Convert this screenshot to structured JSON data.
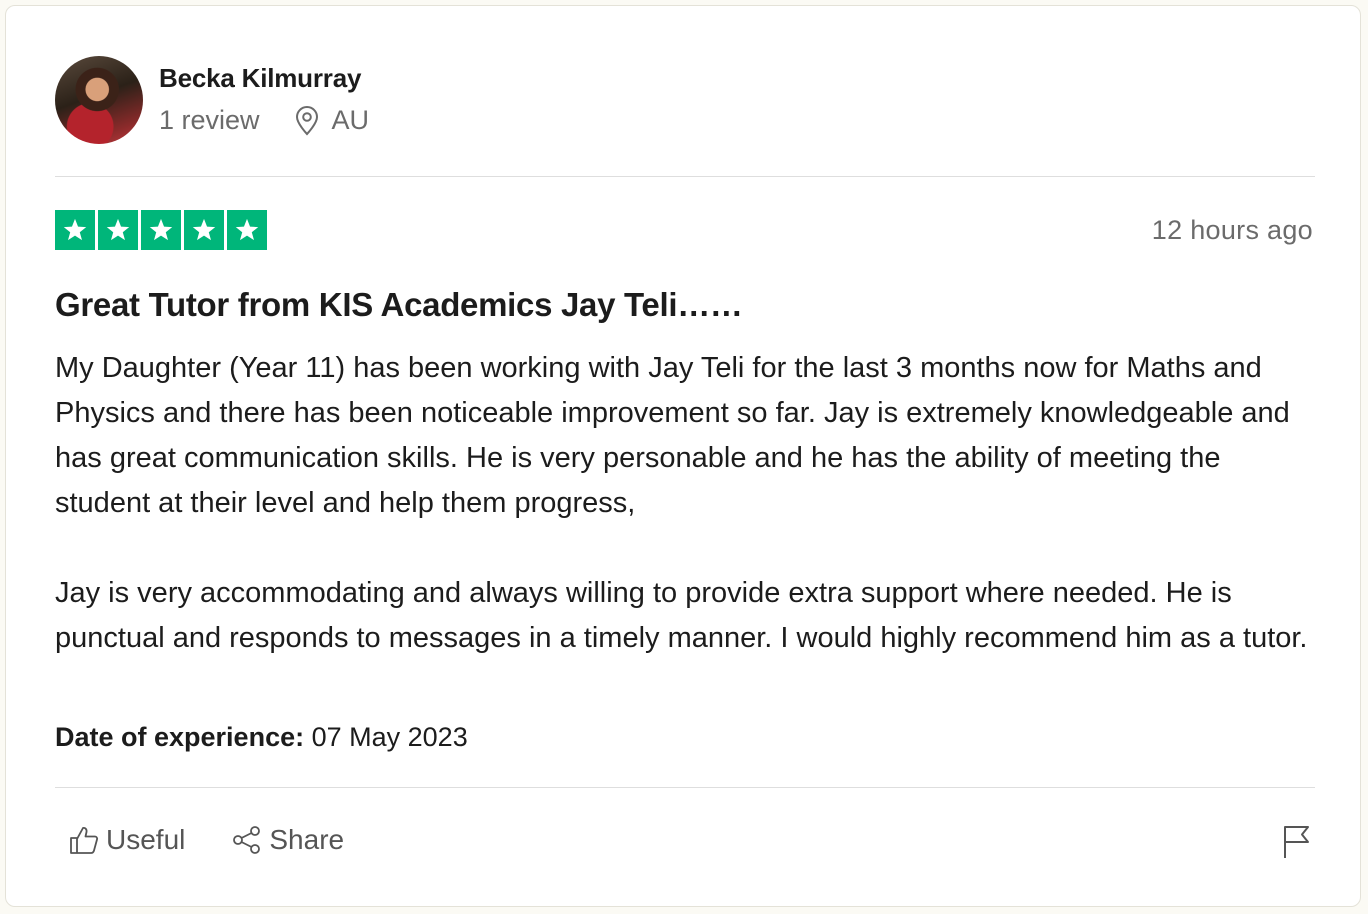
{
  "reviewer": {
    "name": "Becka Kilmurray",
    "review_count": "1 review",
    "country": "AU"
  },
  "review": {
    "rating": 5,
    "rating_color": "#00b67a",
    "posted": "12 hours ago",
    "title": "Great Tutor from KIS Academics Jay Teli……",
    "paragraphs": [
      "My Daughter (Year 11) has been working with Jay Teli for the last 3 months now for Maths and Physics and there has been noticeable improvement so far. Jay is extremely knowledgeable and has great communication skills. He is very personable and he has the ability of meeting the student at their level and help them progress,",
      "Jay is very accommodating and always willing to provide extra support where needed. He is punctual and responds to messages in a timely manner. I would highly recommend him as a tutor."
    ],
    "experience_label": "Date of experience:",
    "experience_date": "07 May 2023"
  },
  "actions": {
    "useful_label": "Useful",
    "share_label": "Share"
  },
  "icons": {
    "location": "location-pin-icon",
    "useful": "thumbs-up-icon",
    "share": "share-icon",
    "report": "flag-icon",
    "star": "star-icon"
  }
}
